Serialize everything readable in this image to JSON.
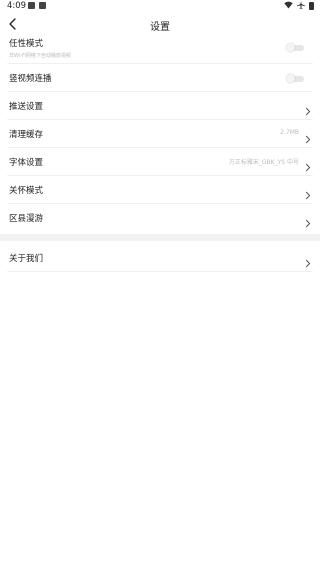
{
  "status_bar": {
    "time": "4:09",
    "left_icons": [
      "image-icon",
      "notification-icon"
    ],
    "right_icons": [
      "wifi-icon",
      "airplane-icon",
      "battery-icon"
    ]
  },
  "header": {
    "title": "设置",
    "back_icon": "back-arrow-icon"
  },
  "settings": [
    {
      "label": "任性模式",
      "sub": "非Wi-Fi网络下自动播放视频",
      "control": "toggle",
      "on": false
    },
    {
      "label": "竖视频连播",
      "control": "toggle",
      "on": false
    },
    {
      "label": "推送设置",
      "control": "chevron"
    },
    {
      "label": "清理缓存",
      "value": "2.7MB",
      "control": "chevron"
    },
    {
      "label": "字体设置",
      "value": "方正标雅宋_GBK_YS 中号",
      "control": "chevron"
    },
    {
      "label": "关怀模式",
      "control": "chevron"
    },
    {
      "label": "区县漫游",
      "control": "chevron"
    }
  ],
  "about": {
    "label": "关于我们",
    "control": "chevron"
  },
  "colors": {
    "background": "#ffffff",
    "divider": "#f0f0f0",
    "section_gap": "#f2f2f2",
    "secondary_text": "#bbbbbb",
    "toggle_off": "#e6e6e6"
  }
}
